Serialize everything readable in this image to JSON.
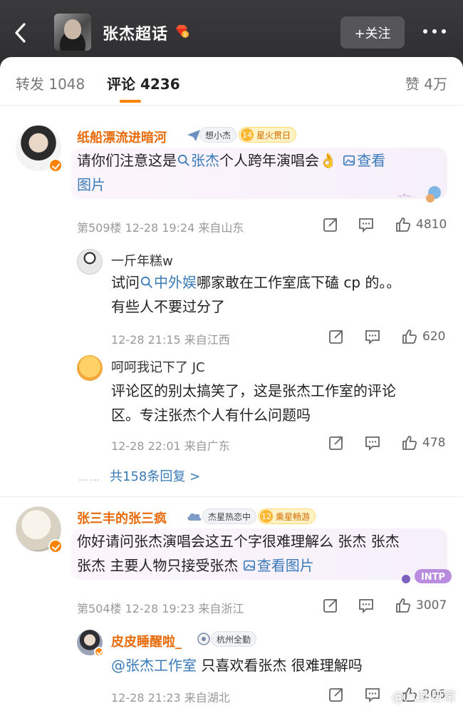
{
  "header": {
    "topic_title": "张杰超话",
    "follow_label": "+关注",
    "icons": {
      "back": "back-chevron-icon",
      "more": "more-dots-icon",
      "badge": "diamond-level-badge-icon"
    }
  },
  "tabs": [
    {
      "label": "转发 1048"
    },
    {
      "label": "评论 4236"
    },
    {
      "label": "赞 4万"
    }
  ],
  "comments": [
    {
      "username": "纸船漂流进暗河",
      "badge_text": "想小杰",
      "level_num": "14",
      "level_text": "星火贯日",
      "text_prefix": "请你们注意这是",
      "topic_link": "张杰",
      "text_mid": "个人跨年演唱会",
      "emoji": "👌",
      "image_link_1": "查看",
      "image_link_2": "图片",
      "meta": "第509楼  12-28 19:24  来自山东",
      "likes": "4810",
      "replies": [
        {
          "username": "一斤年糕w",
          "text_prefix": "试问",
          "topic_link": "中外娱",
          "text_line1_rest": "哪家敢在工作室底下磕 cp 的。。",
          "text_line2": "有些人不要过分了",
          "meta": "12-28 21:15  来自江西",
          "likes": "620"
        },
        {
          "username": "呵呵我记下了 JC",
          "text_line1": "评论区的别太搞笑了，这是张杰工作室的评论",
          "text_line2": "区。专注张杰个人有什么问题吗",
          "meta": "12-28 22:01  来自广东",
          "likes": "478"
        }
      ],
      "more_replies": "共158条回复 >",
      "more_dots": "……"
    },
    {
      "username": "张三丰的张三疯",
      "badge_text": "杰星热恋中",
      "level_num": "12",
      "level_text": "乘星畅游",
      "text_line1": "你好请问张杰演唱会这五个字很难理解么 张杰 张杰",
      "text_line2_prefix": "张杰 主要人物只接受张杰",
      "image_link": "查看图片",
      "sticker_text": "INTP",
      "meta": "第504楼  12-28 19:23  来自浙江",
      "likes": "3007",
      "replies": [
        {
          "username": "皮皮睡醒啦_",
          "badge_text": "杭州全勤",
          "mention": "@张杰工作室",
          "text_rest": " 只喜欢看张杰 很难理解吗",
          "meta": "12-28 21:23  来自湖北",
          "likes": "206"
        }
      ]
    }
  ],
  "watermark": "@八卦日常",
  "colors": {
    "accent": "#ff8200",
    "username": "#e86b0c",
    "link": "#3a7ab8",
    "header_bg": "#2d2d2f"
  }
}
